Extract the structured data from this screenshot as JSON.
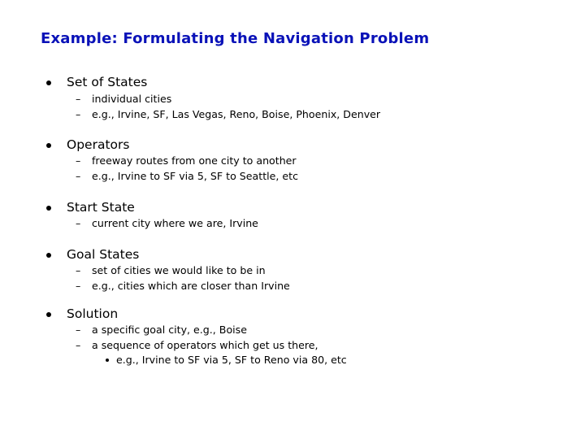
{
  "title": "Example: Formulating the Navigation Problem",
  "sections": [
    {
      "heading": "Set of States",
      "items": [
        {
          "text": "individual cities"
        },
        {
          "text": "e.g., Irvine, SF, Las Vegas, Reno, Boise, Phoenix, Denver"
        }
      ]
    },
    {
      "heading": "Operators",
      "items": [
        {
          "text": "freeway routes from one city to another"
        },
        {
          "text": "e.g., Irvine to SF via 5,  SF to Seattle, etc"
        }
      ]
    },
    {
      "heading": "Start State",
      "items": [
        {
          "text": "current city where we are, Irvine"
        }
      ]
    },
    {
      "heading": "Goal States",
      "items": [
        {
          "text": "set of cities we would like to be in"
        },
        {
          "text": "e.g., cities which are closer than Irvine"
        }
      ]
    },
    {
      "heading": "Solution",
      "items": [
        {
          "text": "a specific goal city, e.g., Boise"
        },
        {
          "text": "a sequence of operators which get us there,",
          "subitems": [
            "e.g.,  Irvine to SF via 5,  SF to Reno via 80, etc"
          ]
        }
      ]
    }
  ],
  "dash_glyph": "–"
}
